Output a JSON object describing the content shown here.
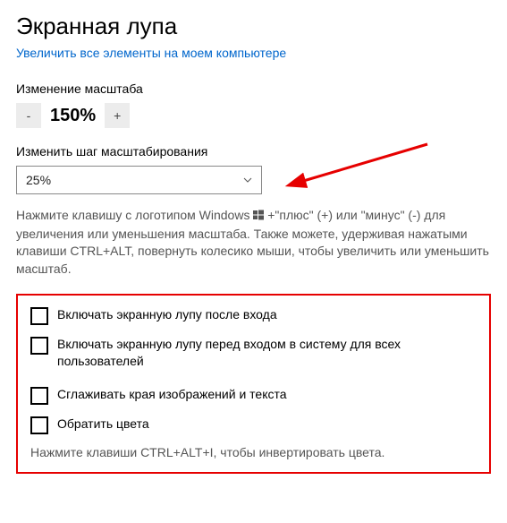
{
  "title": "Экранная лупа",
  "enlarge_link": "Увеличить все элементы на моем компьютере",
  "zoom": {
    "label": "Изменение масштаба",
    "minus": "-",
    "value": "150%",
    "plus": "+"
  },
  "step": {
    "label": "Изменить шаг масштабирования",
    "value": "25%"
  },
  "hint_parts": {
    "p1": "Нажмите клавишу с логотипом Windows ",
    "p2": " +\"плюс\" (+) или \"минус\" (-) для увеличения или уменьшения масштаба. Также можете, удерживая нажатыми клавиши CTRL+ALT, повернуть колесико мыши, чтобы увеличить или уменьшить масштаб."
  },
  "options": {
    "after_signin": "Включать экранную лупу после входа",
    "before_signin": "Включать экранную лупу перед входом в систему для всех пользователей",
    "smooth_edges": "Сглаживать края изображений и текста",
    "invert_colors": "Обратить цвета",
    "invert_hint": "Нажмите клавиши CTRL+ALT+I, чтобы инвертировать цвета."
  },
  "colors": {
    "annotation": "#e60000",
    "link": "#0066cc"
  }
}
